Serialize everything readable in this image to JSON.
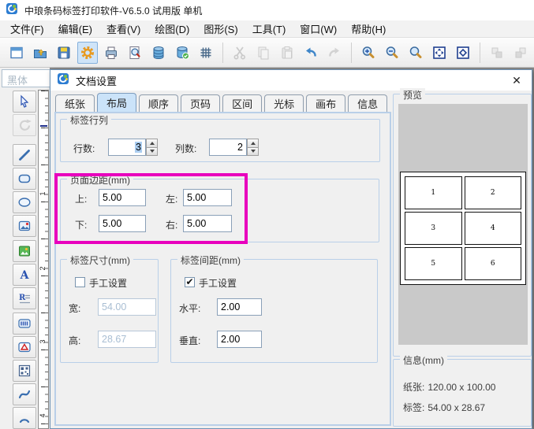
{
  "window": {
    "title": "中琅条码标签打印软件-V6.5.0 试用版 单机"
  },
  "menu": {
    "items": [
      "文件(F)",
      "编辑(E)",
      "查看(V)",
      "绘图(D)",
      "图形(S)",
      "工具(T)",
      "窗口(W)",
      "帮助(H)"
    ]
  },
  "toolbar": {
    "icons": [
      "new-document",
      "open-file",
      "save",
      "document-settings",
      "print",
      "print-preview",
      "database-connect",
      "database-import",
      "grid-toggle",
      "cut",
      "copy",
      "paste",
      "undo",
      "redo",
      "zoom-in",
      "zoom-out",
      "zoom-tool",
      "fit-page",
      "fit-selection",
      "bring-forward",
      "send-backward"
    ],
    "active_icon": "document-settings",
    "disabled_icons": [
      "cut",
      "copy",
      "paste",
      "redo",
      "bring-forward",
      "send-backward"
    ]
  },
  "side": {
    "font_combo_value": "黑体",
    "tools": [
      "select-tool",
      "rotate-tool",
      "line-tool",
      "rounded-rect-tool",
      "ellipse-tool",
      "image-tool",
      "picture-tool",
      "text-tool",
      "richtext-tool",
      "barcode-tool",
      "shape-tool",
      "qrcode-tool",
      "curve-tool",
      "arc-tool"
    ]
  },
  "ruler": {
    "marks": [
      "1",
      "2",
      "3",
      "4"
    ]
  },
  "glyphs": {
    "close": "✕",
    "check": "✔",
    "text_tool": "A",
    "richtext_tool": "R"
  },
  "dialog": {
    "title": "文档设置",
    "tabs": [
      "纸张",
      "布局",
      "顺序",
      "页码",
      "区间",
      "光标",
      "画布",
      "信息"
    ],
    "active_tab": "布局",
    "layout": {
      "rows_cols": {
        "title": "标签行列",
        "rows_label": "行数:",
        "rows_value": "3",
        "cols_label": "列数:",
        "cols_value": "2"
      },
      "margins": {
        "title": "页面边距(mm)",
        "top_label": "上:",
        "top_value": "5.00",
        "left_label": "左:",
        "left_value": "5.00",
        "bottom_label": "下:",
        "bottom_value": "5.00",
        "right_label": "右:",
        "right_value": "5.00"
      },
      "label_size": {
        "title": "标签尺寸(mm)",
        "manual_label": "手工设置",
        "manual_checked": false,
        "width_label": "宽:",
        "width_value": "54.00",
        "height_label": "高:",
        "height_value": "28.67"
      },
      "label_gap": {
        "title": "标签间距(mm)",
        "manual_label": "手工设置",
        "manual_checked": true,
        "horizontal_label": "水平:",
        "horizontal_value": "2.00",
        "vertical_label": "垂直:",
        "vertical_value": "2.00"
      }
    },
    "preview": {
      "title": "预览",
      "labels": [
        "1",
        "2",
        "3",
        "4",
        "5",
        "6"
      ]
    },
    "info": {
      "title": "信息(mm)",
      "paper_label": "纸张:",
      "paper_value": "120.00 x 100.00",
      "label_label": "标签:",
      "label_value": "54.00 x 28.67"
    }
  },
  "colors": {
    "highlight_box": "#e800bd",
    "active_tab_bg": "#cbe3f9",
    "accent_blue": "#3a6fb0"
  }
}
